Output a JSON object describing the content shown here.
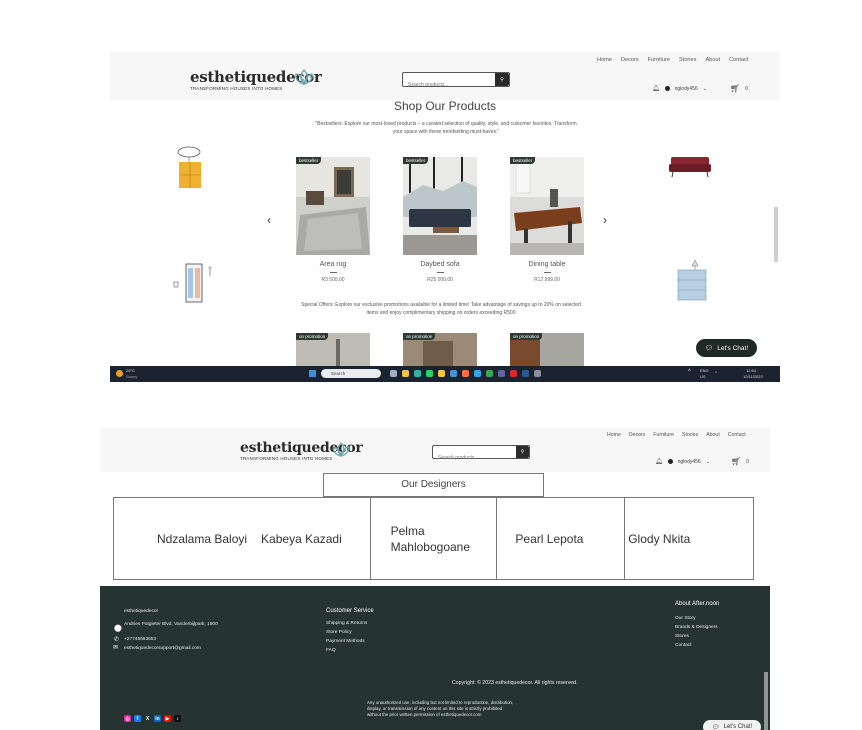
{
  "site": {
    "brand": "esthetiquedecor",
    "tagline": "TRANSFORMING HOUSES INTO HOMES",
    "search_placeholder": "Search products...",
    "nav": [
      "Home",
      "Decors",
      "Furniture",
      "Stories",
      "About",
      "Contact"
    ],
    "user": "nglody456",
    "cart_count": "0"
  },
  "shop": {
    "title": "Shop Our Products",
    "intro": "\"Bestsellers: Explore our most-loved products – a curated selection of quality, style, and customer favorites. Transform your space with these trendsetting must-haves.\"",
    "products": [
      {
        "badge": "bestseller",
        "name": "Area rug",
        "price": "R3 500,00"
      },
      {
        "badge": "bestseller",
        "name": "Daybed sofa",
        "price": "R25 000,00"
      },
      {
        "badge": "bestseller",
        "name": "Dining table",
        "price": "R12 999,00"
      }
    ],
    "special_offers": "Special Offers: Explore our exclusive promotions available for a limited time! Take advantage of savings up to 20% on selected items and enjoy complimentary shipping on orders exceeding R500",
    "promo_badges": [
      "on promotion",
      "on promotion",
      "on promotion"
    ]
  },
  "chat": {
    "label": "Let's Chat!"
  },
  "taskbar": {
    "temp": "29°C",
    "weather": "Sunny",
    "search": "Search",
    "lang": "ENG",
    "region": "US",
    "time": "12:54",
    "date": "12/11/2023"
  },
  "designers": {
    "title": "Our Designers",
    "names": [
      "Ndzalama Baloyi",
      "Kabeya Kazadi",
      "Pelma Mahlobogoane",
      "Pearl Lepota",
      "Glody Nkita"
    ]
  },
  "footer": {
    "brand": "esthetiquedecor",
    "address": "Andries Potgieter Blvd, Vanderbijlpark, 1900",
    "phone": "+27745663653",
    "email": "esthetiquedecorsupport@gmail.com",
    "customer_service_title": "Customer Service",
    "customer_service": [
      "Shipping & Returns",
      "Store Policy",
      "Payment Methods",
      "FAQ"
    ],
    "about_title": "About After.noon",
    "about_links": [
      "Our Story",
      "Brands & Designers",
      "Stores",
      "Contact"
    ],
    "copyright": "Copyright: © 2023 esthetiquedecor. All rights reserved.",
    "legal": "Any unauthorized use, including but not limited to reproduction, distribution, display, or transmission of any content on this site is strictly prohibited without the prior written permission of esthetiquedecor.com"
  },
  "colors": {
    "footer_bg": "#253430",
    "badge_bg": "#2f3a33",
    "taskbar_bg": "#1b2330"
  }
}
